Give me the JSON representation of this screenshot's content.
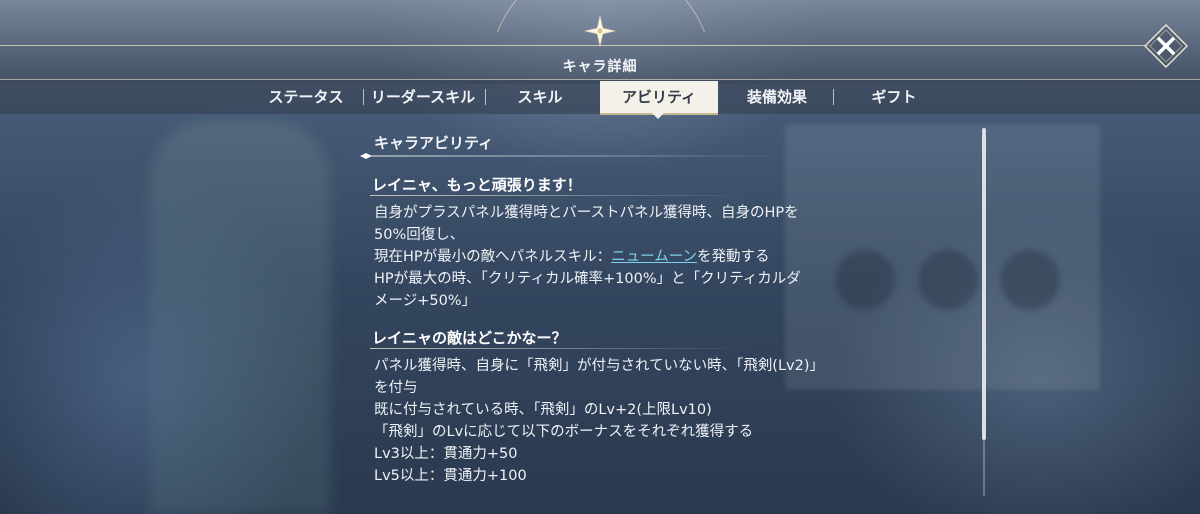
{
  "header": {
    "title": "キャラ詳細"
  },
  "tabs": [
    {
      "label": "ステータス"
    },
    {
      "label": "リーダースキル"
    },
    {
      "label": "スキル"
    },
    {
      "label": "アビリティ",
      "active": true
    },
    {
      "label": "装備効果"
    },
    {
      "label": "ギフト"
    }
  ],
  "section": {
    "title": "キャラアビリティ"
  },
  "abilities": [
    {
      "name": "レイニャ、もっと頑張ります！",
      "lines": [
        "自身がプラスパネル獲得時とバーストパネル獲得時、自身のHPを",
        "50%回復し、",
        {
          "before": "現在HPが最小の敵へパネルスキル：",
          "link": "ニュームーン",
          "after": "を発動する"
        },
        "HPが最大の時、「クリティカル確率+100%」と「クリティカルダ",
        "メージ+50%」"
      ]
    },
    {
      "name": "レイニャの敵はどこかなー？",
      "lines": [
        "パネル獲得時、自身に「飛剣」が付与されていない時、「飛剣(Lv2)」",
        "を付与",
        "既に付与されている時、「飛剣」のLv+2(上限Lv10)",
        "「飛剣」のLvに応じて以下のボーナスをそれぞれ獲得する",
        "Lv3以上：貫通力+50",
        "Lv5以上：貫通力+100"
      ]
    }
  ],
  "icons": {
    "close": "close-x-icon",
    "header_emblem": "compass-star-icon"
  },
  "colors": {
    "link": "#7fd0ee",
    "active_tab_bg": "#f4f1ea",
    "accent_gold": "#c9b98f"
  }
}
